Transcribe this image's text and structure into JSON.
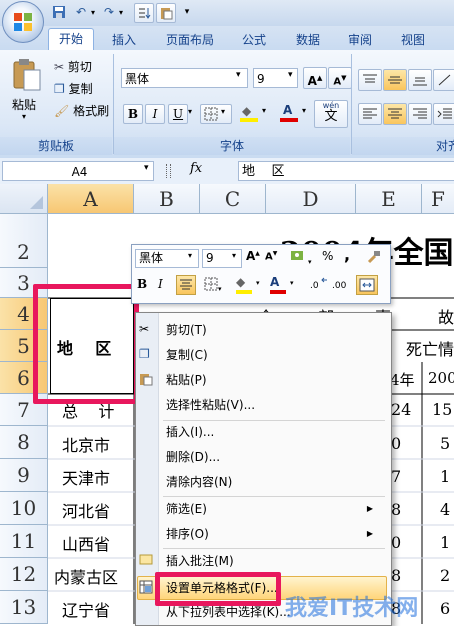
{
  "quick_access": {
    "icons": [
      "save-icon",
      "undo-icon",
      "redo-icon",
      "sort-icon",
      "paste-icon",
      "dropdown-icon"
    ]
  },
  "tabs": [
    {
      "label": "开始",
      "active": true
    },
    {
      "label": "插入"
    },
    {
      "label": "页面布局"
    },
    {
      "label": "公式"
    },
    {
      "label": "数据"
    },
    {
      "label": "审阅"
    },
    {
      "label": "视图"
    }
  ],
  "ribbon": {
    "clipboard": {
      "paste": "粘贴",
      "cut": "剪切",
      "copy": "复制",
      "format_painter": "格式刷",
      "group": "剪贴板"
    },
    "font": {
      "name": "黑体",
      "size": "9",
      "bold": "B",
      "italic": "I",
      "underline": "U",
      "group": "字体",
      "grow": "A",
      "shrink": "A",
      "wen": "wén",
      "wen_char": "文",
      "font_color": "A",
      "fill": "◆"
    },
    "align": {
      "group": "对齐"
    }
  },
  "formula_bar": {
    "name_box": "A4",
    "fx": "fx",
    "content": "地    区"
  },
  "columns": [
    "A",
    "B",
    "C",
    "D",
    "E",
    "F"
  ],
  "rows": [
    "2",
    "3",
    "4",
    "5",
    "6",
    "7",
    "8",
    "9",
    "10",
    "11",
    "12",
    "13"
  ],
  "sheet": {
    "title": "2004年全国",
    "header_row4": [
      "全",
      "部",
      "事",
      "故"
    ],
    "e5": "死亡情",
    "e6": "4年",
    "f6": "200",
    "a4": "地    区",
    "rows": [
      {
        "a": "总    计",
        "e": "24",
        "f": "15"
      },
      {
        "a": "北京市",
        "e": "0",
        "f": "5"
      },
      {
        "a": "天津市",
        "e": "7",
        "f": "1"
      },
      {
        "a": "河北省",
        "e": "8",
        "f": "4"
      },
      {
        "a": "山西省",
        "e": "0",
        "f": "1"
      },
      {
        "a": "内蒙古区",
        "e": "8",
        "f": "2"
      },
      {
        "a": "辽宁省",
        "e": "8",
        "f": "6"
      }
    ]
  },
  "mini_toolbar": {
    "font": "黑体",
    "size": "9",
    "percent": "%",
    "comma": ","
  },
  "context_menu": [
    {
      "label": "剪切(T)",
      "icon": "scissors-icon"
    },
    {
      "label": "复制(C)",
      "icon": "copy-icon"
    },
    {
      "label": "粘贴(P)",
      "icon": "paste-icon"
    },
    {
      "label": "选择性粘贴(V)..."
    },
    {
      "sep": true
    },
    {
      "label": "插入(I)..."
    },
    {
      "label": "删除(D)..."
    },
    {
      "label": "清除内容(N)"
    },
    {
      "sep": true
    },
    {
      "label": "筛选(E)",
      "submenu": true
    },
    {
      "label": "排序(O)",
      "submenu": true
    },
    {
      "sep": true
    },
    {
      "label": "插入批注(M)",
      "icon": "comment-icon"
    },
    {
      "label": "设置单元格格式(F)...",
      "icon": "format-cells-icon",
      "highlighted": true
    },
    {
      "label": "从下拉列表中选择(K)..."
    }
  ],
  "watermark": "我爱IT技术网"
}
